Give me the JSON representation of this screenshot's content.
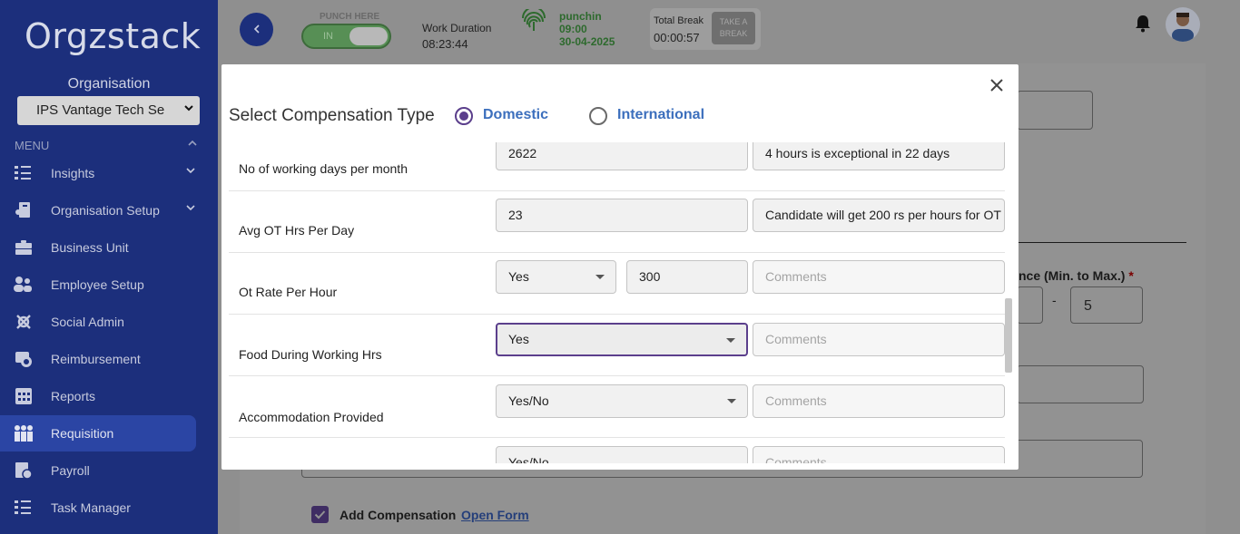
{
  "app": {
    "logo": "Orgzstack"
  },
  "sidebar": {
    "org_label": "Organisation",
    "org_value": "IPS Vantage Tech Se",
    "menu_label": "MENU",
    "items": [
      {
        "label": "Insights",
        "icon": "insights-icon",
        "has_caret": true
      },
      {
        "label": "Organisation Setup",
        "icon": "org-setup-icon",
        "has_caret": true
      },
      {
        "label": "Business Unit",
        "icon": "briefcase-icon"
      },
      {
        "label": "Employee Setup",
        "icon": "people-icon"
      },
      {
        "label": "Social Admin",
        "icon": "social-icon"
      },
      {
        "label": "Reimbursement",
        "icon": "reimbursement-icon"
      },
      {
        "label": "Reports",
        "icon": "reports-icon"
      },
      {
        "label": "Requisition",
        "icon": "requisition-icon",
        "active": true
      },
      {
        "label": "Payroll",
        "icon": "payroll-icon"
      },
      {
        "label": "Task Manager",
        "icon": "task-icon"
      }
    ]
  },
  "topbar": {
    "punch_here": "PUNCH HERE",
    "toggle_label": "IN",
    "work_duration_label": "Work Duration",
    "work_duration_value": "08:23:44",
    "punchin_label": "punchin",
    "punchin_time": "09:00",
    "punchin_date": "30-04-2025",
    "total_break_label": "Total Break",
    "total_break_value": "00:00:57",
    "take_break_line1": "TAKE A",
    "take_break_line2": "BREAK"
  },
  "background": {
    "tolerance_label": "nce (Min. to Max.)",
    "required_mark": "*",
    "range_separator": "-",
    "range_max": "5",
    "add_compensation": "Add Compensation",
    "open_form": "Open Form"
  },
  "modal": {
    "title": "Select Compensation Type",
    "options": [
      {
        "label": "Domestic",
        "selected": true
      },
      {
        "label": "International",
        "selected": false
      }
    ],
    "rows": [
      {
        "label": "No of working days per month",
        "value": "2622",
        "comment": "4 hours is exceptional in 22 days"
      },
      {
        "label": "Avg OT Hrs Per Day",
        "value": "23",
        "comment": "Candidate will get 200 rs per hours for OT"
      },
      {
        "label": "Ot Rate Per Hour",
        "select_value": "Yes",
        "value": "300",
        "comment_placeholder": "Comments"
      },
      {
        "label": "Food During Working Hrs",
        "select_value": "Yes",
        "comment_placeholder": "Comments"
      },
      {
        "label": "Accommodation Provided",
        "select_value": "Yes/No",
        "comment_placeholder": "Comments"
      },
      {
        "label": "",
        "select_value": "Yes/No",
        "comment_placeholder": "Comments"
      }
    ]
  },
  "colors": {
    "sidebar_bg": "#1c2f7c",
    "accent_purple": "#5b3f8c",
    "radio_label_blue": "#3c6fbd",
    "punch_green": "#2d6a2d"
  }
}
